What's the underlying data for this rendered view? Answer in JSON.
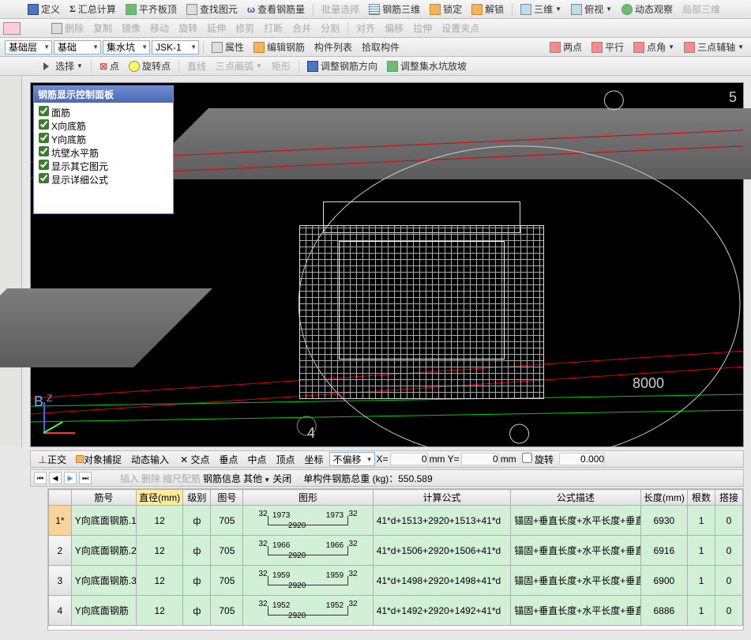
{
  "toolbars": {
    "row1": [
      "定义",
      "汇总计算",
      "平齐板顶",
      "查找图元",
      "查看钢筋量",
      "批量选择",
      "钢筋三维",
      "锁定",
      "解锁",
      "三维",
      "俯视",
      "动态观察",
      "局部三维"
    ],
    "row2": [
      "删除",
      "复制",
      "镜像",
      "移动",
      "旋转",
      "延伸",
      "修剪",
      "打断",
      "合并",
      "分割",
      "对齐",
      "偏移",
      "拉伸",
      "设置夹点"
    ],
    "row3": {
      "sel1": "基础层",
      "sel2": "基础",
      "sel3": "集水坑",
      "sel4": "JSK-1",
      "btns": [
        "属性",
        "编辑钢筋",
        "构件列表",
        "拾取构件"
      ],
      "right": [
        "两点",
        "平行",
        "点角",
        "三点辅轴"
      ]
    },
    "row4": {
      "sel": "选择",
      "btns": [
        "点",
        "旋转点",
        "直线",
        "三点画弧",
        "矩形",
        "调整钢筋方向",
        "调整集水坑放坡"
      ]
    }
  },
  "panel": {
    "title": "钢筋显示控制面板",
    "items": [
      "面筋",
      "X向底筋",
      "Y向底筋",
      "坑壁水平筋",
      "显示其它图元",
      "显示详细公式"
    ]
  },
  "view": {
    "dim1": "8000",
    "dim2": "5",
    "dim3": "4",
    "axisZ": "Z",
    "axisB": "B"
  },
  "statusbar": {
    "btns": [
      "正交",
      "对象捕捉",
      "动态输入"
    ],
    "snaps": [
      "交点",
      "垂点",
      "中点",
      "顶点",
      "坐标"
    ],
    "offset_label": "不偏移",
    "x": "X=",
    "x_val": "0",
    "y": "mm Y=",
    "y_val": "0",
    "r": "mm",
    "rot": "旋转",
    "rot_val": "0.000"
  },
  "navbar": {
    "btns": [
      "插入",
      "删除",
      "缩尺配筋",
      "钢筋信息",
      "其他",
      "关闭"
    ],
    "total_label": "单构件钢筋总重 (kg)：",
    "total": "550.589"
  },
  "table": {
    "headers": [
      "",
      "筋号",
      "直径(mm)",
      "级别",
      "图号",
      "图形",
      "计算公式",
      "公式描述",
      "长度(mm)",
      "根数",
      "搭接"
    ],
    "rows": [
      {
        "n": "1*",
        "active": true,
        "name": "Y向底面钢筋.1",
        "dia": "12",
        "lvl": "ф",
        "pic": "705",
        "shape": {
          "tl": "32",
          "ml": "1973",
          "br": "2920",
          "mr": "1973",
          "tr": "32"
        },
        "formula": "41*d+1513+2920+1513+41*d",
        "desc": "锚固+垂直长度+水平长度+垂直长度+锚固",
        "len": "6930",
        "cnt": "1",
        "lap": "0"
      },
      {
        "n": "2",
        "name": "Y向底面钢筋.2",
        "dia": "12",
        "lvl": "ф",
        "pic": "705",
        "shape": {
          "tl": "32",
          "ml": "1966",
          "br": "2920",
          "mr": "1966",
          "tr": "32"
        },
        "formula": "41*d+1506+2920+1506+41*d",
        "desc": "锚固+垂直长度+水平长度+垂直长度+锚固",
        "len": "6916",
        "cnt": "1",
        "lap": "0"
      },
      {
        "n": "3",
        "name": "Y向底面钢筋.3",
        "dia": "12",
        "lvl": "ф",
        "pic": "705",
        "shape": {
          "tl": "32",
          "ml": "1959",
          "br": "2920",
          "mr": "1959",
          "tr": "32"
        },
        "formula": "41*d+1498+2920+1498+41*d",
        "desc": "锚固+垂直长度+水平长度+垂直长度+锚固",
        "len": "6900",
        "cnt": "1",
        "lap": "0"
      },
      {
        "n": "4",
        "name": "Y向底面钢筋",
        "dia": "12",
        "lvl": "ф",
        "pic": "705",
        "shape": {
          "tl": "32",
          "ml": "1952",
          "br": "2920",
          "mr": "1952",
          "tr": "32"
        },
        "formula": "41*d+1492+2920+1492+41*d",
        "desc": "锚固+垂直长度+水平长度+垂直长度+锚固",
        "len": "6886",
        "cnt": "1",
        "lap": "0"
      }
    ]
  }
}
